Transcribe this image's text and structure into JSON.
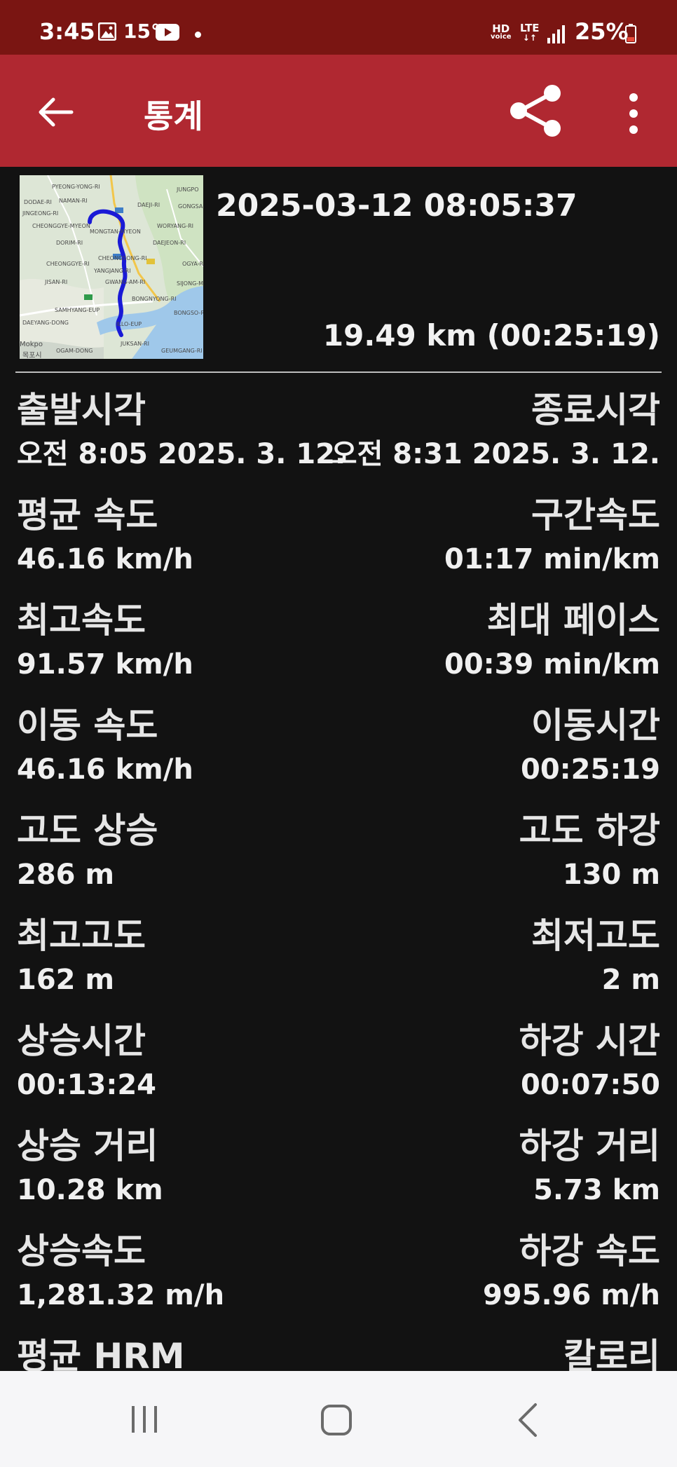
{
  "status_bar": {
    "time": "3:45",
    "temperature": "15°",
    "hd_line1": "HD",
    "hd_line2": "voice",
    "lte": "LTE",
    "battery": "25%"
  },
  "app_bar": {
    "title": "통계",
    "icons": [
      "back-arrow-icon",
      "share-icon",
      "more-vert-icon"
    ]
  },
  "summary": {
    "start_datetime": "2025-03-12 08:05:37",
    "distance_duration": "19.49 km (00:25:19)",
    "map_labels": {
      "l1": "PYEONG-YONG-RI",
      "l2": "NAMAN-RI",
      "l3": "DODAE-RI",
      "l4": "JINGEONG-RI",
      "l5": "CHEONGGYE-MYEON",
      "l6": "DORIM-RI",
      "l7": "CHEONGGYE-RI",
      "l8": "JISAN-RI",
      "l9": "SAMHYANG-EUP",
      "l10": "DAEYANG-DONG",
      "l11": "OGAM-DONG",
      "l12": "MONGTAN-MYEON",
      "l13": "CHEONGSONG-RI",
      "l14": "YANGJANG-RI",
      "l15": "GWANG-AM-RI",
      "l16": "BONGNYONG-RI",
      "l17": "ILLO-EUP",
      "l18": "JUKSAN-RI",
      "l19": "GEUMGANG-RI",
      "l20": "DAEJI-RI",
      "l21": "WORYANG-RI",
      "l22": "DAEJEON-RI",
      "l23": "OGYA-RI",
      "l24": "SIJONG-M",
      "l25": "BONGSO-RI",
      "l26": "JUNGPO",
      "l27": "GONGSA",
      "l28": "Mokpo",
      "l29": "목포시"
    }
  },
  "stats": [
    {
      "left_label": "출발시각",
      "left_value": "오전 8:05 2025. 3. 12.",
      "right_label": "종료시각",
      "right_value": "오전 8:31 2025. 3. 12."
    },
    {
      "left_label": "평균 속도",
      "left_value": "46.16 km/h",
      "right_label": "구간속도",
      "right_value": "01:17 min/km"
    },
    {
      "left_label": "최고속도",
      "left_value": "91.57 km/h",
      "right_label": "최대 페이스",
      "right_value": "00:39 min/km"
    },
    {
      "left_label": "이동 속도",
      "left_value": "46.16 km/h",
      "right_label": "이동시간",
      "right_value": "00:25:19"
    },
    {
      "left_label": "고도 상승",
      "left_value": "286 m",
      "right_label": "고도 하강",
      "right_value": "130 m"
    },
    {
      "left_label": "최고고도",
      "left_value": "162 m",
      "right_label": "최저고도",
      "right_value": "2 m"
    },
    {
      "left_label": "상승시간",
      "left_value": "00:13:24",
      "right_label": "하강 시간",
      "right_value": "00:07:50"
    },
    {
      "left_label": "상승 거리",
      "left_value": "10.28 km",
      "right_label": "하강 거리",
      "right_value": "5.73 km"
    },
    {
      "left_label": "상승속도",
      "left_value": "1,281.32 m/h",
      "right_label": "하강 속도",
      "right_value": "995.96 m/h"
    },
    {
      "left_label": "평균 HRM",
      "left_value": "",
      "right_label": "칼로리",
      "right_value": ""
    }
  ],
  "colors": {
    "status_bar": "#7a1512",
    "app_bar": "#b02831",
    "background": "#121212",
    "route": "#1a1ad6",
    "nav_bar": "#f6f6f8"
  },
  "nav_bar": {
    "icons": [
      "recents-icon",
      "home-icon",
      "back-icon"
    ]
  }
}
